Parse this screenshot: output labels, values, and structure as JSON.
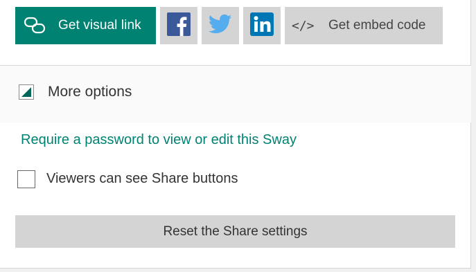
{
  "share_row": {
    "visual_link_label": "Get visual link",
    "visual_link_icon": "link-icon",
    "facebook_icon": "facebook-icon",
    "twitter_icon": "twitter-icon",
    "linkedin_icon": "linkedin-icon",
    "embed_icon_glyph": "</>",
    "embed_label": "Get embed code"
  },
  "more_options": {
    "label": "More options",
    "expanded": true
  },
  "password_link": "Require a password to view or edit this Sway",
  "viewers_share": {
    "label": "Viewers can see Share buttons",
    "checked": false
  },
  "reset_label": "Reset the Share settings",
  "colors": {
    "accent": "#008272",
    "button_bg": "#d4d4d4",
    "facebook": "#3b5998",
    "twitter": "#55acee",
    "linkedin": "#0077b5"
  }
}
